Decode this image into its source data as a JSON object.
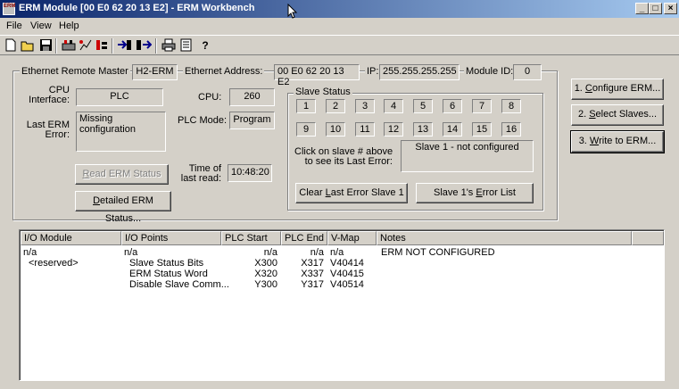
{
  "window": {
    "title": "ERM Module [00 E0 62 20 13 E2] - ERM Workbench",
    "icon_text": "ERM",
    "minimize": "_",
    "restore": "□",
    "close": "×"
  },
  "menu": [
    "File",
    "View",
    "Help"
  ],
  "toolbar_icons": [
    "new-icon",
    "open-icon",
    "save-icon",
    "erm-icon",
    "network-icon",
    "tools-icon",
    "arrow-in-icon",
    "arrow-out-icon",
    "print-icon",
    "list-icon",
    "help-icon"
  ],
  "group": {
    "master_label": "Ethernet Remote Master",
    "master_value": "H2-ERM",
    "address_label": "Ethernet Address:",
    "address_value": "00 E0 62 20 13 E2",
    "ip_label": "IP:",
    "ip_value": "255.255.255.255",
    "module_label": "Module ID:",
    "module_value": "0",
    "cpu_interface_label1": "CPU",
    "cpu_interface_label2": "Interface:",
    "cpu_interface_value": "PLC",
    "cpu_label": "CPU:",
    "cpu_value": "260",
    "last_error_label1": "Last ERM",
    "last_error_label2": "Error:",
    "last_error_value": "Missing configuration",
    "plc_mode_label": "PLC Mode:",
    "plc_mode_value": "Program",
    "read_status_btn_pre": "",
    "read_status_btn_key": "R",
    "read_status_btn_post": "ead ERM Status",
    "time_label1": "Time of",
    "time_label2": "last read:",
    "time_value": "10:48:20",
    "detailed_btn_key": "D",
    "detailed_btn_post": "etailed ERM Status...",
    "slave_status_label": "Slave Status",
    "slaves_row1": [
      "1",
      "2",
      "3",
      "4",
      "5",
      "6",
      "7",
      "8"
    ],
    "slaves_row2": [
      "9",
      "10",
      "11",
      "12",
      "13",
      "14",
      "15",
      "16"
    ],
    "click_hint1": "Click on slave # above",
    "click_hint2": "to see its Last Error:",
    "slave_error": "Slave 1 - not configured",
    "clear_btn_pre": "Clear ",
    "clear_btn_key": "L",
    "clear_btn_post": "ast Error Slave 1",
    "errorlist_btn_pre": "Slave 1's ",
    "errorlist_btn_key": "E",
    "errorlist_btn_post": "rror List"
  },
  "side_buttons": [
    {
      "pre": "1. ",
      "key": "C",
      "post": "onfigure ERM..."
    },
    {
      "pre": "2. ",
      "key": "S",
      "post": "elect Slaves..."
    },
    {
      "pre": "3. ",
      "key": "W",
      "post": "rite to ERM..."
    }
  ],
  "table": {
    "headers": [
      "I/O Module",
      "I/O Points",
      "PLC Start",
      "PLC End",
      "V-Map",
      "Notes"
    ],
    "rows": [
      [
        "n/a",
        "n/a",
        "n/a",
        "n/a",
        "n/a",
        "ERM NOT CONFIGURED"
      ],
      [
        "<reserved>",
        "Slave Status Bits",
        "X300",
        "X317",
        "V40414",
        ""
      ],
      [
        "",
        "ERM Status Word",
        "X320",
        "X337",
        "V40415",
        ""
      ],
      [
        "",
        "Disable Slave Comm...",
        "Y300",
        "Y317",
        "V40514",
        ""
      ]
    ]
  }
}
